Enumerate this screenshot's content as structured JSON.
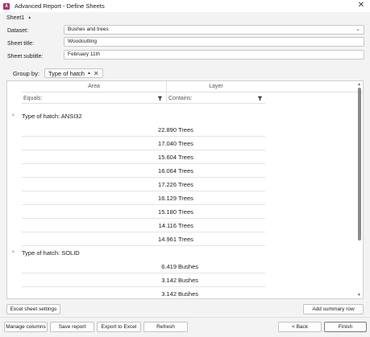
{
  "window": {
    "title": "Advanced Report - Define Sheets",
    "icon": "app-logo-icon",
    "close_glyph": "✕"
  },
  "tabs": [
    {
      "label": "Sheet1",
      "caret": "▲"
    }
  ],
  "form": {
    "dataset_label": "Dataset:",
    "dataset_value": "Bushes and trees",
    "sheet_title_label": "Sheet title:",
    "sheet_title_value": "Woodcutting",
    "sheet_subtitle_label": "Sheet subtitle:",
    "sheet_subtitle_value": "February 11th"
  },
  "group_by": {
    "label": "Group by:",
    "chip_label": "Type of hatch",
    "chip_sort": "▲",
    "chip_close": "✕"
  },
  "grid": {
    "columns": [
      {
        "header": "Area",
        "filter_label": "Equals:"
      },
      {
        "header": "Layer",
        "filter_label": "Contains:"
      }
    ],
    "groups": [
      {
        "title": "Type of hatch: ANSI32",
        "caret": "^",
        "rows": [
          {
            "area": "22.890",
            "layer": "Trees"
          },
          {
            "area": "17.040",
            "layer": "Trees"
          },
          {
            "area": "15.604",
            "layer": "Trees"
          },
          {
            "area": "16.064",
            "layer": "Trees"
          },
          {
            "area": "17.226",
            "layer": "Trees"
          },
          {
            "area": "16.129",
            "layer": "Trees"
          },
          {
            "area": "15.180",
            "layer": "Trees"
          },
          {
            "area": "14.116",
            "layer": "Trees"
          },
          {
            "area": "14.961",
            "layer": "Trees"
          }
        ]
      },
      {
        "title": "Type of hatch: SOLID",
        "caret": "^",
        "rows": [
          {
            "area": "6.419",
            "layer": "Bushes"
          },
          {
            "area": "3.142",
            "layer": "Bushes"
          },
          {
            "area": "3.142",
            "layer": "Bushes"
          }
        ]
      }
    ]
  },
  "buttons": {
    "excel_sheet_settings": "Excel sheet settings",
    "add_summary_row": "Add summary row",
    "manage_columns": "Manage columns",
    "save_report": "Save report",
    "export_to_excel": "Export to Excel",
    "refresh": "Refresh",
    "back": "< Back",
    "finish": "Finish"
  },
  "colors": {
    "accent_icon": "#b0306a",
    "window_bg": "#f3f3f3",
    "grid_bg": "#ffffff"
  }
}
